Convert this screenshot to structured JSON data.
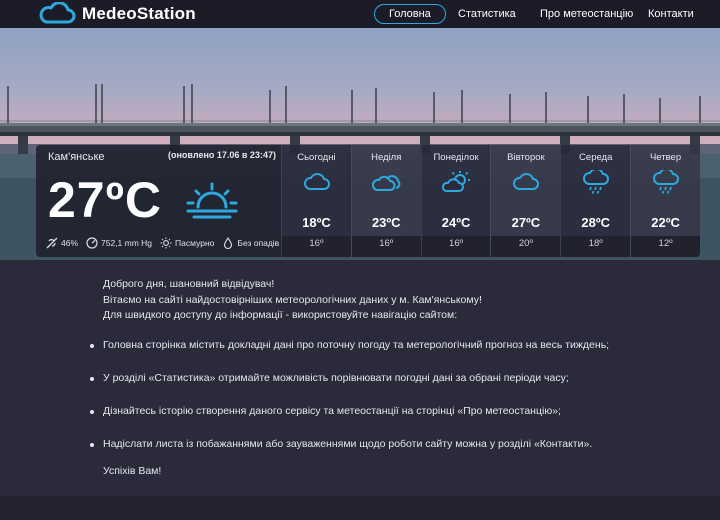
{
  "header": {
    "site_name": "MedeoStation",
    "nav": [
      {
        "label": "Головна",
        "active": true
      },
      {
        "label": "Статистика",
        "active": false
      },
      {
        "label": "Про метеостанцію",
        "active": false
      },
      {
        "label": "Контакти",
        "active": false
      }
    ]
  },
  "current": {
    "city": "Кам'янське",
    "updated": "(оновлено 17.06 в 23:47)",
    "temperature": "27ºC",
    "icon": "partly-sunny-icon",
    "humidity": "46%",
    "pressure": "752,1 mm Hg",
    "wind": "Пасмурно",
    "precipitation": "Без опадів"
  },
  "forecast": [
    {
      "day": "Сьогодні",
      "high": "18ºC",
      "low": "16º",
      "icon": "cloud-icon"
    },
    {
      "day": "Неділя",
      "high": "23ºC",
      "low": "16º",
      "icon": "cloudy-icon"
    },
    {
      "day": "Понеділок",
      "high": "24ºC",
      "low": "16º",
      "icon": "partly-sunny-icon"
    },
    {
      "day": "Вівторок",
      "high": "27ºC",
      "low": "20º",
      "icon": "cloud-icon"
    },
    {
      "day": "Середа",
      "high": "28ºC",
      "low": "18º",
      "icon": "rain-icon"
    },
    {
      "day": "Четвер",
      "high": "22ºC",
      "low": "12º",
      "icon": "rain-icon"
    }
  ],
  "content": {
    "intro": [
      "Доброго дня, шановний відвідувач!",
      "Вітаємо на сайті найдостовірніших метеорологічних даних у м. Кам'янському!",
      "Для швидкого доступу до інформації - використовуйте навігацію сайтом:"
    ],
    "bullets": [
      "Головна сторінка містить докладні дані про поточну погоду та метерологічний прогноз на весь тиждень;",
      "У розділі «Статистика» отримайте можливість порівнювати погодні дані за обрані періоди часу;",
      "Дізнайтесь історію створення даного сервісу та метеостанції на сторінці «Про метеостанцію»;",
      "Надіслати листа із побажаннями або зауваженнями щодо роботи сайту можна у розділі «Контакти»."
    ],
    "closing": "Успіхів Вам!"
  },
  "colors": {
    "accent": "#2ea8df",
    "background": "#2a2a3a",
    "header": "#1c1c28"
  }
}
